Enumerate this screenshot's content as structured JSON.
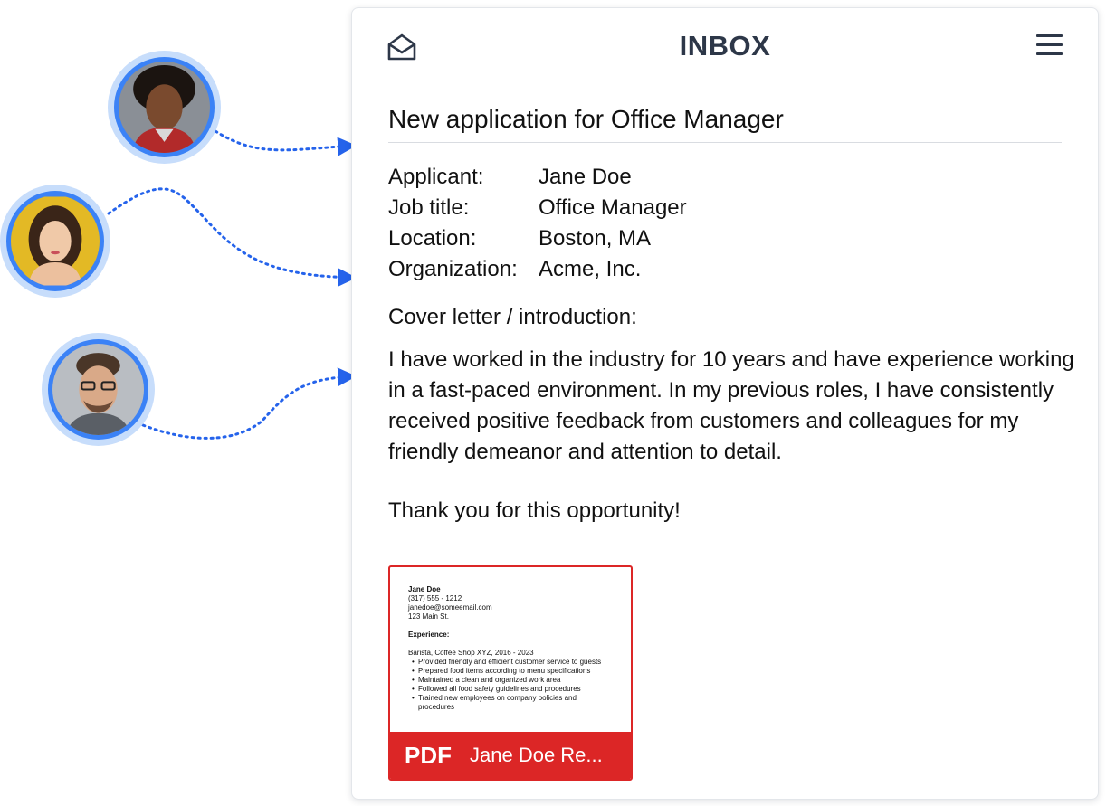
{
  "header": {
    "title": "INBOX",
    "left_icon": "envelope-open-icon",
    "right_icon": "hamburger-menu-icon"
  },
  "message": {
    "subject": "New application for Office Manager",
    "fields": [
      {
        "label": "Applicant:",
        "value": "Jane Doe"
      },
      {
        "label": "Job title:",
        "value": "Office Manager"
      },
      {
        "label": "Location:",
        "value": "Boston, MA"
      },
      {
        "label": "Organization:",
        "value": "Acme, Inc."
      }
    ],
    "cover_heading": "Cover letter / introduction:",
    "cover_text": "I have worked in the industry for 10 years and have experience working in a fast-paced environment. In my previous roles, I have consistently received positive feedback from customers and colleagues for my friendly demeanor and attention to detail.",
    "closing": "Thank you for this opportunity!"
  },
  "attachment": {
    "type_label": "PDF",
    "file_name": "Jane Doe Re...",
    "preview": {
      "name": "Jane Doe",
      "phone": "(317) 555 - 1212",
      "email": "janedoe@someemail.com",
      "address": "123 Main St.",
      "experience_heading": "Experience:",
      "job": "Barista, Coffee Shop XYZ, 2016 - 2023",
      "bullets": [
        "Provided friendly and efficient customer service to guests",
        "Prepared food items according to menu specifications",
        "Maintained a clean and organized work area",
        "Followed all food safety guidelines and procedures",
        "Trained new employees on company policies and procedures"
      ]
    }
  },
  "colors": {
    "accent_blue": "#3b82f6",
    "ring_light": "#c7ddfb",
    "connector": "#2563eb",
    "attachment_red": "#dc2626",
    "header_text": "#2d3748"
  }
}
